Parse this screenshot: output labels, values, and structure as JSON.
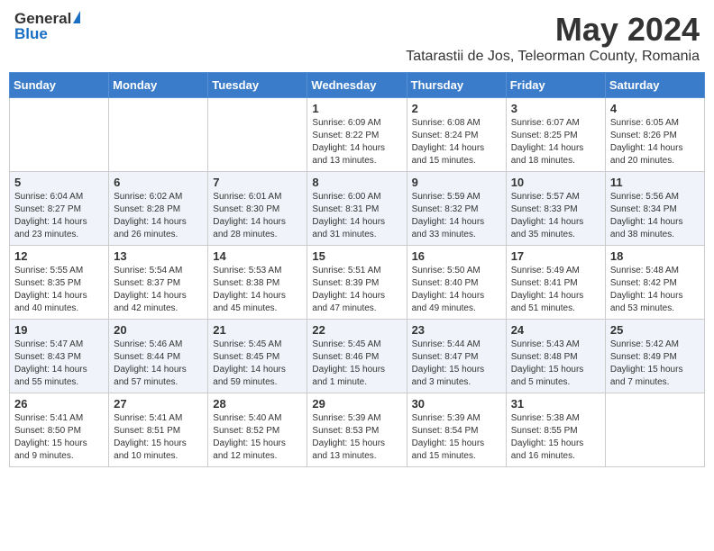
{
  "header": {
    "logo_general": "General",
    "logo_blue": "Blue",
    "month_title": "May 2024",
    "location": "Tatarastii de Jos, Teleorman County, Romania"
  },
  "days_of_week": [
    "Sunday",
    "Monday",
    "Tuesday",
    "Wednesday",
    "Thursday",
    "Friday",
    "Saturday"
  ],
  "weeks": [
    [
      {
        "day": "",
        "info": ""
      },
      {
        "day": "",
        "info": ""
      },
      {
        "day": "",
        "info": ""
      },
      {
        "day": "1",
        "info": "Sunrise: 6:09 AM\nSunset: 8:22 PM\nDaylight: 14 hours\nand 13 minutes."
      },
      {
        "day": "2",
        "info": "Sunrise: 6:08 AM\nSunset: 8:24 PM\nDaylight: 14 hours\nand 15 minutes."
      },
      {
        "day": "3",
        "info": "Sunrise: 6:07 AM\nSunset: 8:25 PM\nDaylight: 14 hours\nand 18 minutes."
      },
      {
        "day": "4",
        "info": "Sunrise: 6:05 AM\nSunset: 8:26 PM\nDaylight: 14 hours\nand 20 minutes."
      }
    ],
    [
      {
        "day": "5",
        "info": "Sunrise: 6:04 AM\nSunset: 8:27 PM\nDaylight: 14 hours\nand 23 minutes."
      },
      {
        "day": "6",
        "info": "Sunrise: 6:02 AM\nSunset: 8:28 PM\nDaylight: 14 hours\nand 26 minutes."
      },
      {
        "day": "7",
        "info": "Sunrise: 6:01 AM\nSunset: 8:30 PM\nDaylight: 14 hours\nand 28 minutes."
      },
      {
        "day": "8",
        "info": "Sunrise: 6:00 AM\nSunset: 8:31 PM\nDaylight: 14 hours\nand 31 minutes."
      },
      {
        "day": "9",
        "info": "Sunrise: 5:59 AM\nSunset: 8:32 PM\nDaylight: 14 hours\nand 33 minutes."
      },
      {
        "day": "10",
        "info": "Sunrise: 5:57 AM\nSunset: 8:33 PM\nDaylight: 14 hours\nand 35 minutes."
      },
      {
        "day": "11",
        "info": "Sunrise: 5:56 AM\nSunset: 8:34 PM\nDaylight: 14 hours\nand 38 minutes."
      }
    ],
    [
      {
        "day": "12",
        "info": "Sunrise: 5:55 AM\nSunset: 8:35 PM\nDaylight: 14 hours\nand 40 minutes."
      },
      {
        "day": "13",
        "info": "Sunrise: 5:54 AM\nSunset: 8:37 PM\nDaylight: 14 hours\nand 42 minutes."
      },
      {
        "day": "14",
        "info": "Sunrise: 5:53 AM\nSunset: 8:38 PM\nDaylight: 14 hours\nand 45 minutes."
      },
      {
        "day": "15",
        "info": "Sunrise: 5:51 AM\nSunset: 8:39 PM\nDaylight: 14 hours\nand 47 minutes."
      },
      {
        "day": "16",
        "info": "Sunrise: 5:50 AM\nSunset: 8:40 PM\nDaylight: 14 hours\nand 49 minutes."
      },
      {
        "day": "17",
        "info": "Sunrise: 5:49 AM\nSunset: 8:41 PM\nDaylight: 14 hours\nand 51 minutes."
      },
      {
        "day": "18",
        "info": "Sunrise: 5:48 AM\nSunset: 8:42 PM\nDaylight: 14 hours\nand 53 minutes."
      }
    ],
    [
      {
        "day": "19",
        "info": "Sunrise: 5:47 AM\nSunset: 8:43 PM\nDaylight: 14 hours\nand 55 minutes."
      },
      {
        "day": "20",
        "info": "Sunrise: 5:46 AM\nSunset: 8:44 PM\nDaylight: 14 hours\nand 57 minutes."
      },
      {
        "day": "21",
        "info": "Sunrise: 5:45 AM\nSunset: 8:45 PM\nDaylight: 14 hours\nand 59 minutes."
      },
      {
        "day": "22",
        "info": "Sunrise: 5:45 AM\nSunset: 8:46 PM\nDaylight: 15 hours\nand 1 minute."
      },
      {
        "day": "23",
        "info": "Sunrise: 5:44 AM\nSunset: 8:47 PM\nDaylight: 15 hours\nand 3 minutes."
      },
      {
        "day": "24",
        "info": "Sunrise: 5:43 AM\nSunset: 8:48 PM\nDaylight: 15 hours\nand 5 minutes."
      },
      {
        "day": "25",
        "info": "Sunrise: 5:42 AM\nSunset: 8:49 PM\nDaylight: 15 hours\nand 7 minutes."
      }
    ],
    [
      {
        "day": "26",
        "info": "Sunrise: 5:41 AM\nSunset: 8:50 PM\nDaylight: 15 hours\nand 9 minutes."
      },
      {
        "day": "27",
        "info": "Sunrise: 5:41 AM\nSunset: 8:51 PM\nDaylight: 15 hours\nand 10 minutes."
      },
      {
        "day": "28",
        "info": "Sunrise: 5:40 AM\nSunset: 8:52 PM\nDaylight: 15 hours\nand 12 minutes."
      },
      {
        "day": "29",
        "info": "Sunrise: 5:39 AM\nSunset: 8:53 PM\nDaylight: 15 hours\nand 13 minutes."
      },
      {
        "day": "30",
        "info": "Sunrise: 5:39 AM\nSunset: 8:54 PM\nDaylight: 15 hours\nand 15 minutes."
      },
      {
        "day": "31",
        "info": "Sunrise: 5:38 AM\nSunset: 8:55 PM\nDaylight: 15 hours\nand 16 minutes."
      },
      {
        "day": "",
        "info": ""
      }
    ]
  ]
}
